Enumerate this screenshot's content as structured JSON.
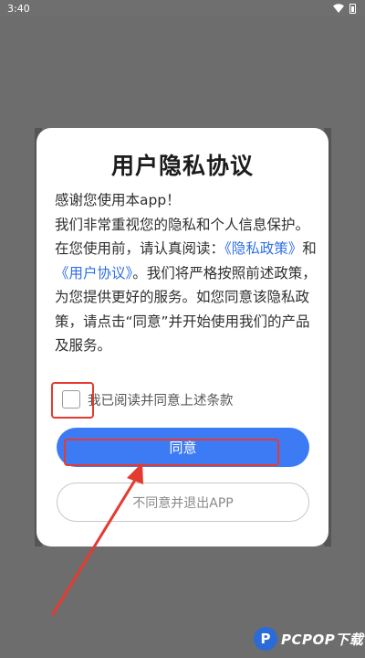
{
  "status_bar": {
    "time": "3:40"
  },
  "dialog": {
    "title": "用户隐私协议",
    "body": {
      "greeting": "感谢您使用本app！",
      "para_before": "我们非常重视您的隐私和个人信息保护。在您使用前，请认真阅读：",
      "link_privacy": "《隐私政策》",
      "and": "和",
      "link_agreement": "《用户协议》",
      "para_after": "。我们将严格按照前述政策，为您提供更好的服务。如您同意该隐私政策，请点击“同意”并开始使用我们的产品及服务。"
    },
    "checkbox_label": "我已阅读并同意上述条款",
    "agree_label": "同意",
    "decline_label": "不同意并退出APP"
  },
  "watermark": {
    "logo_letter": "P",
    "text": "PCPOP下载"
  },
  "colors": {
    "accent": "#3d7bf5",
    "link": "#2f6fe8",
    "annotation": "#e53a30",
    "overlay": "#6d6d6d"
  }
}
